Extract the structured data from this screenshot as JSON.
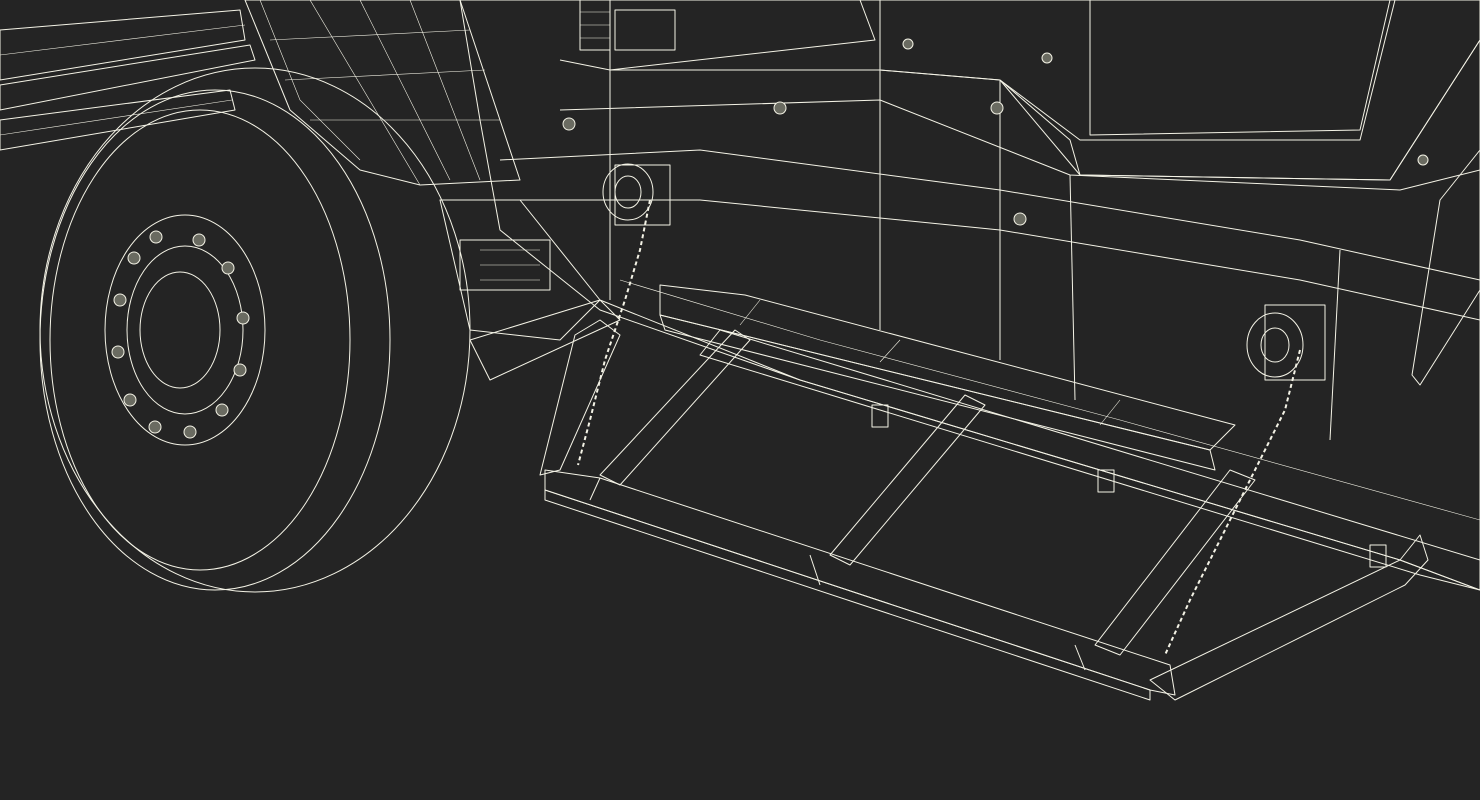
{
  "scene": {
    "background": "#242424",
    "surface": "#6e6f64",
    "surface_light": "#85867a",
    "surface_dark": "#56574e",
    "wire": "#f4f3e6",
    "subject": "wireframe-render-vehicle-side-step"
  }
}
